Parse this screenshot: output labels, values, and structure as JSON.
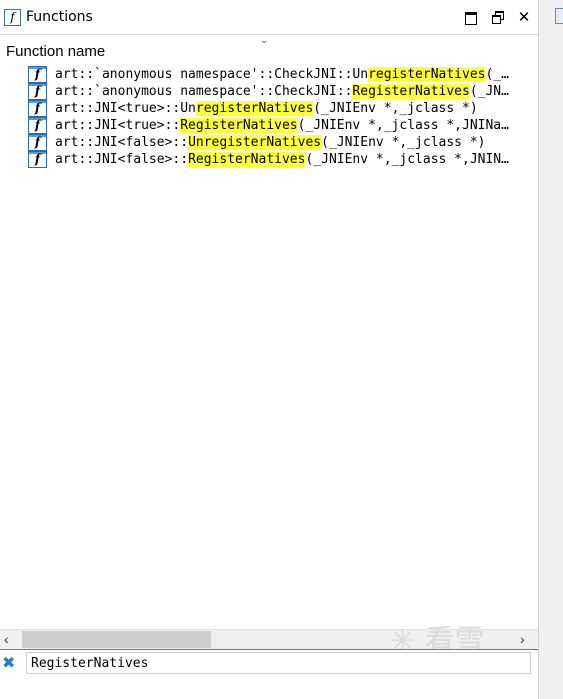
{
  "window": {
    "title": "Functions",
    "title_icon": "f"
  },
  "column": {
    "name": "Function name"
  },
  "functions": [
    {
      "pre": "art::`anonymous namespace'::CheckJNI::Un",
      "hl": "registerNatives",
      "post": "(_…"
    },
    {
      "pre": "art::`anonymous namespace'::CheckJNI::",
      "hl": "RegisterNatives",
      "post": "(_JN…"
    },
    {
      "pre": "art::JNI<true>::Un",
      "hl": "registerNatives",
      "post": "(_JNIEnv *,_jclass *)"
    },
    {
      "pre": "art::JNI<true>::",
      "hl": "RegisterNatives",
      "post": "(_JNIEnv *,_jclass *,JNINa…"
    },
    {
      "pre": "art::JNI<false>::",
      "hl": "UnregisterNatives",
      "post": "(_JNIEnv *,_jclass *)"
    },
    {
      "pre": "art::JNI<false>::",
      "hl": "RegisterNatives",
      "post": "(_JNIEnv *,_jclass *,JNIN…"
    }
  ],
  "search": {
    "value": "RegisterNatives"
  },
  "watermark": "✳ 看雪",
  "colors": {
    "highlight": "#ffff40",
    "clear_icon": "#1e7fd4"
  }
}
